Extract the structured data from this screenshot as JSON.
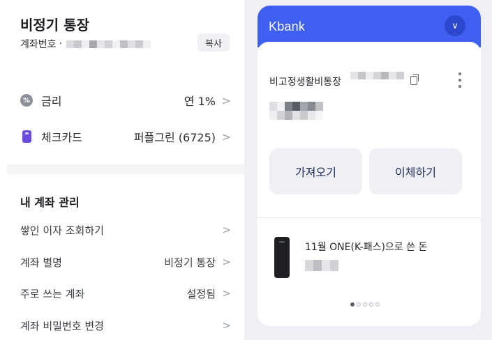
{
  "account": {
    "title": "비정기 통장",
    "number_label": "계좌번호",
    "number_sep": "·",
    "copy_label": "복사"
  },
  "info": {
    "rate_icon": "percent-icon",
    "rate_label": "금리",
    "rate_value": "연 1%",
    "card_icon": "card-icon",
    "card_label": "체크카드",
    "card_value": "퍼플그린 (6725)"
  },
  "manage": {
    "title": "내 계좌 관리",
    "items": [
      {
        "label": "쌓인 이자 조회하기",
        "value": ""
      },
      {
        "label": "계좌 별명",
        "value": "비정기 통장"
      },
      {
        "label": "주로 쓰는 계좌",
        "value": "설정됨"
      },
      {
        "label": "계좌 비밀번호 변경",
        "value": ""
      }
    ]
  },
  "kbank": {
    "logo": "Kbank",
    "header_color": "#3e5ff0",
    "account_name": "비고정생활비통장",
    "buttons": {
      "left": "가져오기",
      "right": "이체하기"
    },
    "spend_text": "11월 ONE(K-패스)으로 쓴 돈",
    "pager": {
      "count": 5,
      "active": 0
    }
  },
  "chevron": ">",
  "down_chevron": "∨"
}
